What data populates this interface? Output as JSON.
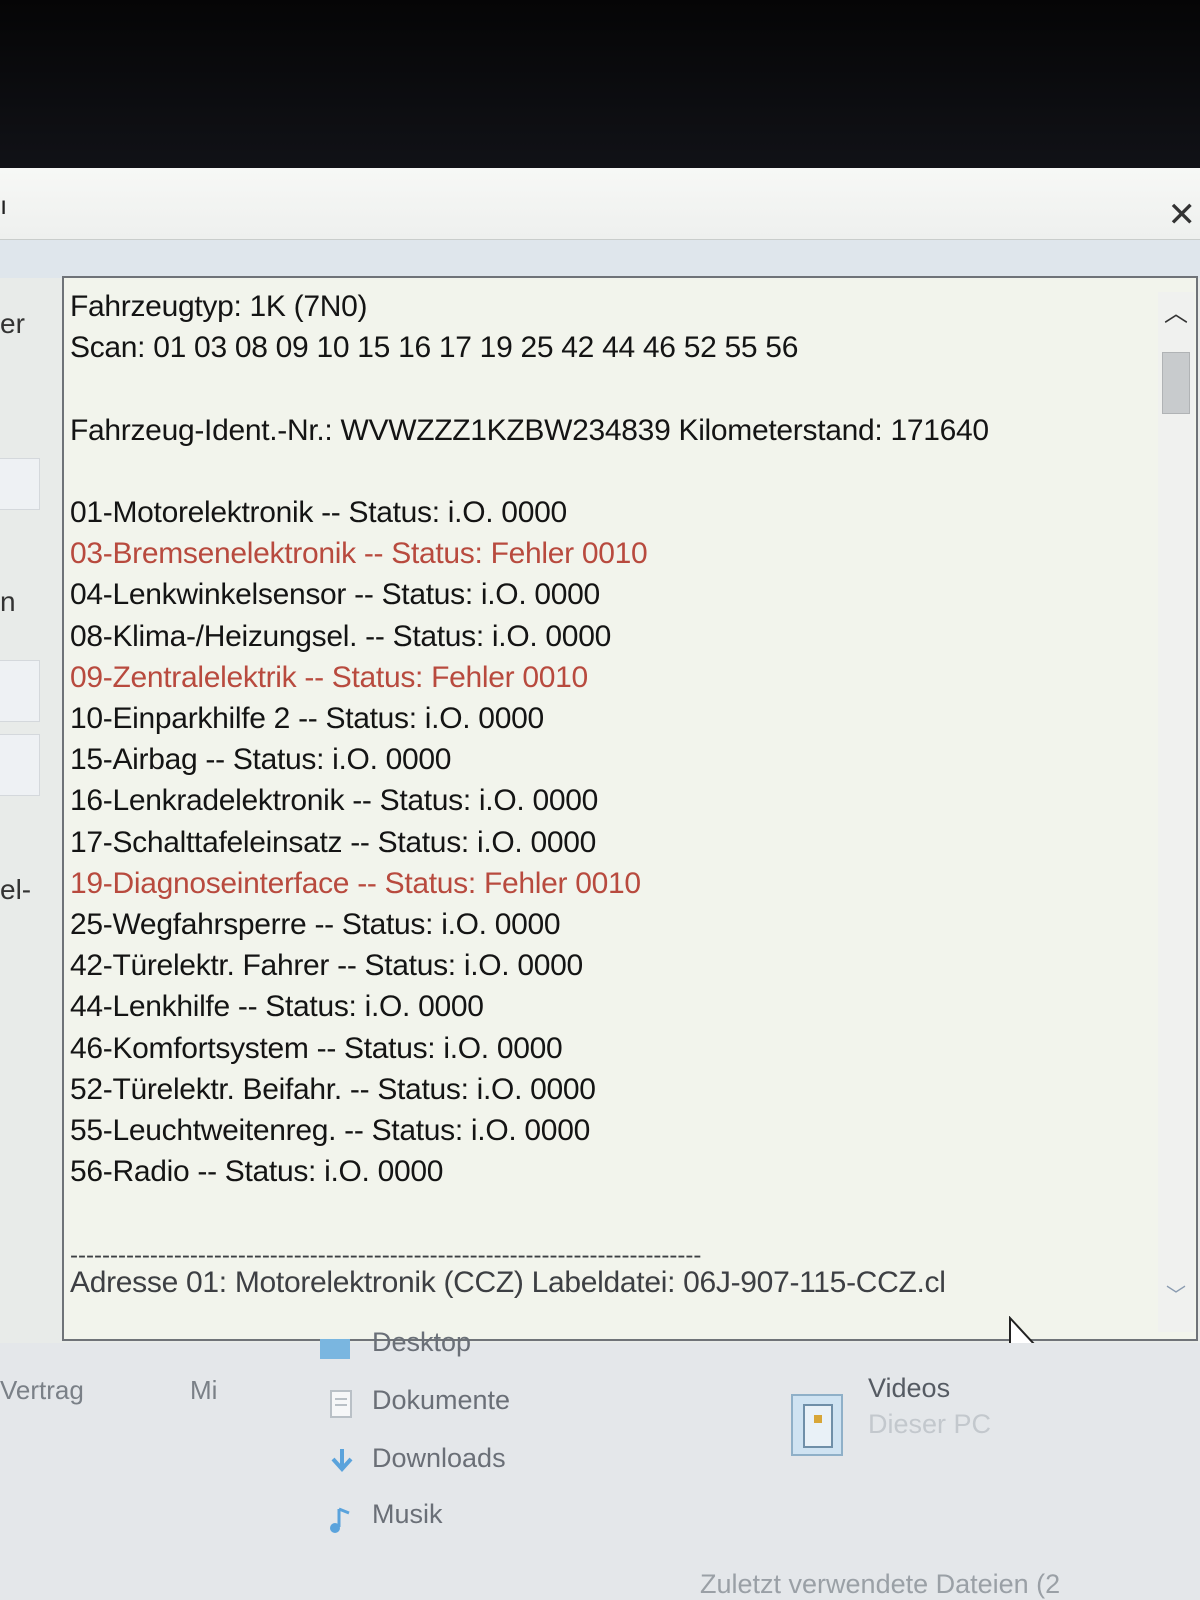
{
  "window": {
    "title_fragment": "ı",
    "close_icon": "close-icon",
    "left_fragments": [
      "er",
      "n",
      "el-"
    ]
  },
  "scan": {
    "lines": [
      {
        "text": "Fahrzeugtyp: 1K (7N0)",
        "error": false
      },
      {
        "text": "Scan: 01 03 08 09 10 15 16 17 19 25 42 44 46 52 55 56",
        "error": false
      },
      {
        "text": "",
        "error": false
      },
      {
        "text": "Fahrzeug-Ident.-Nr.: WVWZZZ1KZBW234839   Kilometerstand: 171640",
        "error": false
      },
      {
        "text": "",
        "error": false
      },
      {
        "text": "01-Motorelektronik -- Status: i.O. 0000",
        "error": false
      },
      {
        "text": "03-Bremsenelektronik -- Status: Fehler 0010",
        "error": true
      },
      {
        "text": "04-Lenkwinkelsensor -- Status: i.O. 0000",
        "error": false
      },
      {
        "text": "08-Klima-/Heizungsel. -- Status: i.O. 0000",
        "error": false
      },
      {
        "text": "09-Zentralelektrik -- Status: Fehler 0010",
        "error": true
      },
      {
        "text": "10-Einparkhilfe 2 -- Status: i.O. 0000",
        "error": false
      },
      {
        "text": "15-Airbag -- Status: i.O. 0000",
        "error": false
      },
      {
        "text": "16-Lenkradelektronik -- Status: i.O. 0000",
        "error": false
      },
      {
        "text": "17-Schalttafeleinsatz -- Status: i.O. 0000",
        "error": false
      },
      {
        "text": "19-Diagnoseinterface -- Status: Fehler 0010",
        "error": true
      },
      {
        "text": "25-Wegfahrsperre -- Status: i.O. 0000",
        "error": false
      },
      {
        "text": "42-Türelektr. Fahrer -- Status: i.O. 0000",
        "error": false
      },
      {
        "text": "44-Lenkhilfe -- Status: i.O. 0000",
        "error": false
      },
      {
        "text": "46-Komfortsystem -- Status: i.O. 0000",
        "error": false
      },
      {
        "text": "52-Türelektr. Beifahr. -- Status: i.O. 0000",
        "error": false
      },
      {
        "text": "55-Leuchtweitenreg. -- Status: i.O. 0000",
        "error": false
      },
      {
        "text": "56-Radio -- Status: i.O. 0000",
        "error": false
      },
      {
        "text": "",
        "error": false
      },
      {
        "text": "-------------------------------------------------------------------------------",
        "error": false
      },
      {
        "text": "Adresse 01: Motorelektronik (CCZ)      Labeldatei: 06J-907-115-CCZ.cl",
        "error": false
      }
    ],
    "colors": {
      "ok": "#141414",
      "error": "#b84a3e"
    }
  },
  "scrollbar": {
    "up_icon": "chevron-up-icon",
    "down_icon": "chevron-down-icon"
  },
  "explorer": {
    "nav": [
      {
        "label": "Desktop",
        "icon": "desktop-icon"
      },
      {
        "label": "Dokumente",
        "icon": "documents-icon"
      },
      {
        "label": "Downloads",
        "icon": "downloads-icon"
      },
      {
        "label": "Musik",
        "icon": "music-icon"
      }
    ],
    "tabs": [
      "Vertrag",
      "Mi"
    ],
    "videos_label": "Videos",
    "location": "Dieser PC",
    "recent": "Zuletzt verwendete Dateien (2"
  }
}
